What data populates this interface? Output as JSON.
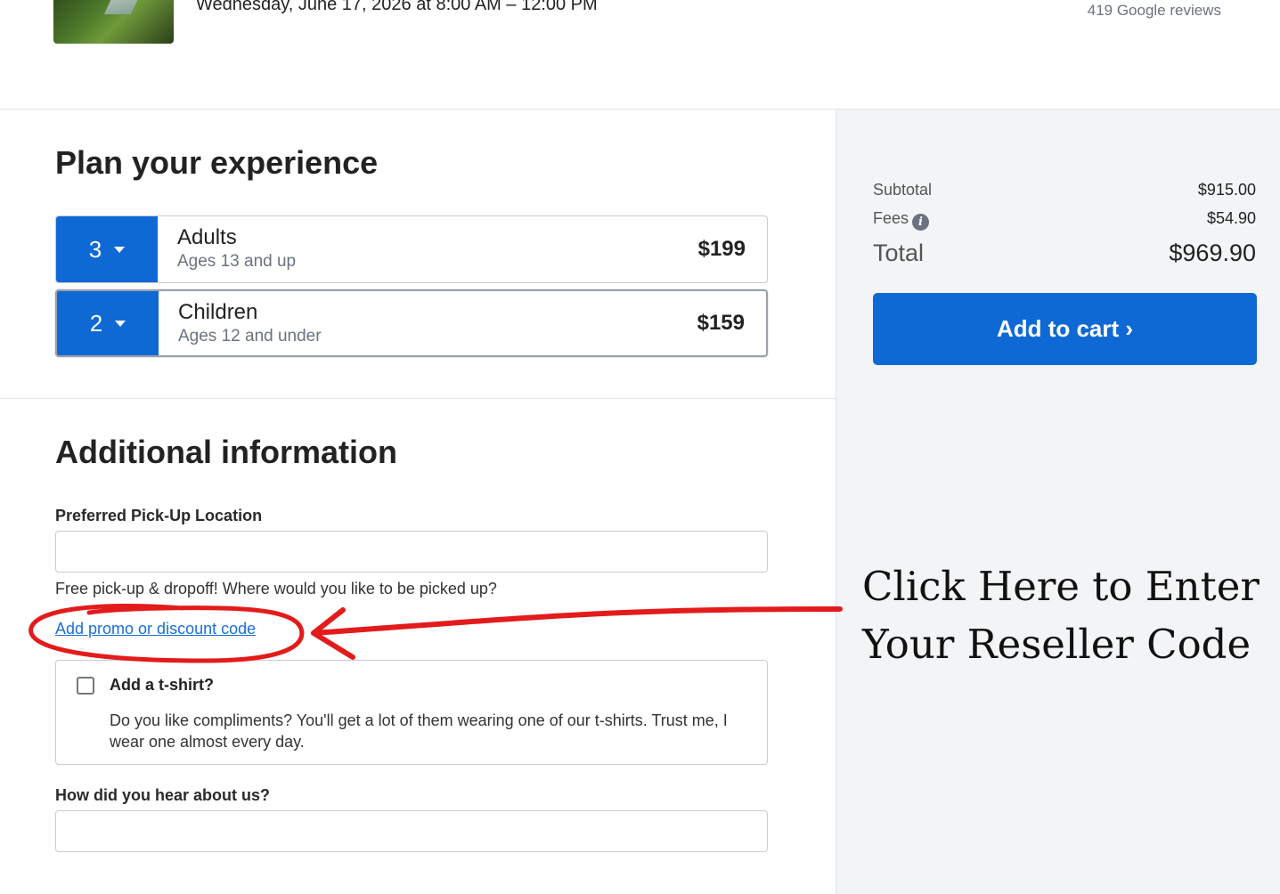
{
  "header": {
    "event_date": "Wednesday, June 17, 2026 at 8:00 AM – 12:00 PM",
    "reviews": "419 Google reviews"
  },
  "plan": {
    "title": "Plan your experience",
    "tickets": [
      {
        "qty": "3",
        "name": "Adults",
        "age": "Ages 13 and up",
        "price": "$199"
      },
      {
        "qty": "2",
        "name": "Children",
        "age": "Ages 12 and under",
        "price": "$159"
      }
    ]
  },
  "summary": {
    "subtotal_label": "Subtotal",
    "subtotal_value": "$915.00",
    "fees_label": "Fees",
    "fees_value": "$54.90",
    "total_label": "Total",
    "total_value": "$969.90",
    "cart_button": "Add to cart ›"
  },
  "additional": {
    "title": "Additional information",
    "pickup_label": "Preferred Pick-Up Location",
    "pickup_value": "",
    "pickup_help": "Free pick-up & dropoff! Where would you like to be picked up?",
    "promo_link": "Add promo or discount code",
    "tshirt_title": "Add a t-shirt?",
    "tshirt_desc": "Do you like compliments? You'll get a lot of them wearing one of our t-shirts. Trust me, I wear one almost every day.",
    "tshirt_checked": false,
    "hear_label": "How did you hear about us?",
    "hear_value": ""
  },
  "annotation": {
    "line1": "Click Here to Enter",
    "line2": "Your Reseller  Code",
    "color": "#e31b1b"
  },
  "colors": {
    "accent": "#0f69d4",
    "sidebar_bg": "#f3f4f6",
    "link": "#1a6fd8"
  },
  "icons": {
    "fees_info": "info-icon",
    "qty_dropdown": "chevron-down-icon"
  }
}
